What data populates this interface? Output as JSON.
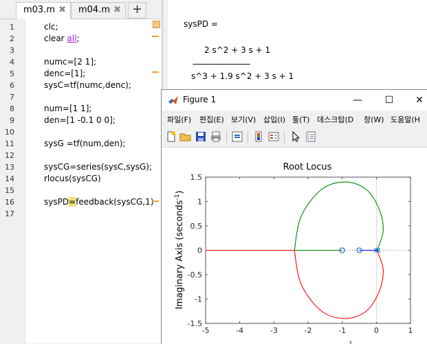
{
  "editor": {
    "tabs": [
      {
        "label": "m03.m",
        "close": "✖",
        "active": true
      },
      {
        "label": "m04.m",
        "close": "✖",
        "active": false
      }
    ],
    "add_tab": "+",
    "lines": [
      {
        "num": "1",
        "pre": "clc;",
        "kw": "",
        "post": ""
      },
      {
        "num": "2",
        "pre": "clear ",
        "kw": "all",
        "post": ";"
      },
      {
        "num": "3",
        "pre": "",
        "kw": "",
        "post": ""
      },
      {
        "num": "4",
        "pre": "numc=[2 1];",
        "kw": "",
        "post": ""
      },
      {
        "num": "5",
        "pre": "denc=[1];",
        "kw": "",
        "post": ""
      },
      {
        "num": "6",
        "pre": "sysC=tf(numc,denc);",
        "kw": "",
        "post": ""
      },
      {
        "num": "7",
        "pre": "",
        "kw": "",
        "post": ""
      },
      {
        "num": "8",
        "pre": "num=[1 1];",
        "kw": "",
        "post": ""
      },
      {
        "num": "9",
        "pre": "den=[1 -0.1 0 0];",
        "kw": "",
        "post": ""
      },
      {
        "num": "10",
        "pre": "",
        "kw": "",
        "post": ""
      },
      {
        "num": "11",
        "pre": "sysG =tf(num,den);",
        "kw": "",
        "post": ""
      },
      {
        "num": "12",
        "pre": "",
        "kw": "",
        "post": ""
      },
      {
        "num": "13",
        "pre": "sysCG=series(sysC,sysG);",
        "kw": "",
        "post": ""
      },
      {
        "num": "14",
        "pre": "rlocus(sysCG)",
        "kw": "",
        "post": ""
      },
      {
        "num": "15",
        "pre": "",
        "kw": "",
        "post": ""
      },
      {
        "num": "16",
        "pre": "sysPD",
        "hl": "=",
        "kw": "",
        "post": "feedback(sysCG,1)"
      },
      {
        "num": "17",
        "pre": "",
        "kw": "",
        "post": ""
      }
    ]
  },
  "command_window": {
    "var_line": "sysPD =",
    "numerator": "2 s^2 + 3 s + 1",
    "divider": "-------------------------",
    "denominator": "s^3 + 1.9 s^2 + 3 s + 1"
  },
  "figure": {
    "title": "Figure 1",
    "minimize": "—",
    "maximize": "☐",
    "close": "✕",
    "menus": [
      "파일(F)",
      "편집(E)",
      "보기(V)",
      "삽입(I)",
      "툴(T)",
      "데스크탑(D",
      "창(W)",
      "도움말(H"
    ],
    "toolbar_icons": [
      "new-figure-icon",
      "open-icon",
      "save-icon",
      "print-icon",
      "link-icon",
      "colorbar-icon",
      "legend-icon",
      "pointer-icon",
      "property-editor-icon"
    ]
  },
  "chart_data": {
    "type": "line",
    "title": "Root Locus",
    "ylabel": "Imaginary Axis (seconds",
    "ylabel_sup": "-1",
    "ylabel_end": ")",
    "xlabel_fragment": "1",
    "xlim": [
      -5,
      1
    ],
    "ylim": [
      -1.5,
      1.5
    ],
    "xticks": [
      "-5",
      "-4",
      "-3",
      "-2",
      "-1",
      "0",
      "1"
    ],
    "yticks": [
      "1.5",
      "1",
      "0.5",
      "0",
      "-0.5",
      "-1",
      "-1.5"
    ],
    "zeros": [
      [
        -1,
        0
      ],
      [
        -0.5,
        0
      ]
    ],
    "poles": [
      [
        0,
        0
      ],
      [
        0.05,
        0
      ]
    ],
    "series": [
      {
        "color": "#ff0000",
        "x": [
          -5.0,
          -2.4
        ],
        "y": [
          0,
          0
        ]
      },
      {
        "color": "#007f00",
        "x": [
          -2.4,
          -1.0
        ],
        "y": [
          0,
          0
        ]
      },
      {
        "color": "#0000ff",
        "x": [
          -0.5,
          0.0
        ],
        "y": [
          0,
          0
        ]
      },
      {
        "color": "#007f00",
        "x": [
          0.03,
          0.2,
          0.08,
          -0.3,
          -0.9,
          -1.6,
          -2.2,
          -2.4
        ],
        "y": [
          0.02,
          0.4,
          0.85,
          1.25,
          1.4,
          1.25,
          0.7,
          0.0
        ]
      },
      {
        "color": "#ff0000",
        "x": [
          0.03,
          0.2,
          0.08,
          -0.3,
          -0.9,
          -1.6,
          -2.2,
          -2.4
        ],
        "y": [
          -0.02,
          -0.4,
          -0.85,
          -1.25,
          -1.4,
          -1.25,
          -0.7,
          0.0
        ]
      }
    ],
    "grid": false
  }
}
